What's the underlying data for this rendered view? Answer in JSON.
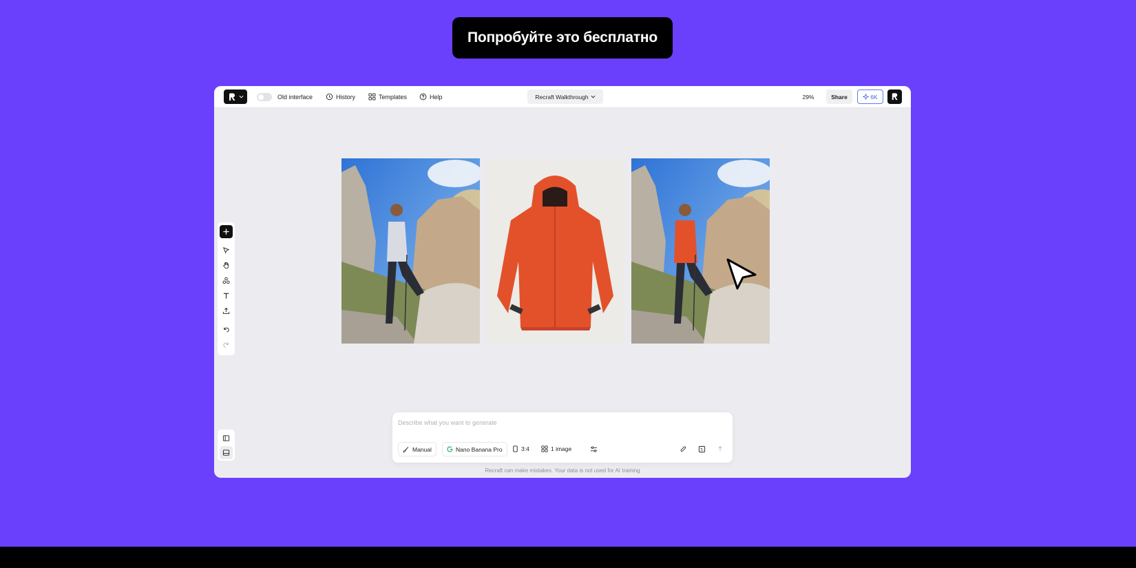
{
  "cta": {
    "label": "Попробуйте это бесплатно"
  },
  "colors": {
    "page_background": "#6a40fd",
    "accent": "#4a5fd8",
    "dark": "#111111"
  },
  "header": {
    "toggle_label": "Old interface",
    "history_label": "History",
    "templates_label": "Templates",
    "help_label": "Help",
    "project_name": "Recraft Walkthrough",
    "zoom": "29%",
    "share_label": "Share",
    "credits": "6K"
  },
  "toolbar": {
    "tools": [
      "add-icon",
      "select-cursor-icon",
      "hand-icon",
      "shapes-icon",
      "text-icon",
      "upload-icon",
      "undo-icon",
      "redo-icon"
    ]
  },
  "canvas": {
    "images": [
      "hiker-in-grey-jacket",
      "orange-rain-jacket",
      "hiker-in-orange-jacket"
    ]
  },
  "prompt": {
    "placeholder": "Describe what you want to generate",
    "mode_label": "Manual",
    "model_label": "Nano Banana Pro",
    "ratio_label": "3:4",
    "count_label": "1 image"
  },
  "footer": {
    "disclaimer": "Recraft can make mistakes. Your data is not used for AI training"
  }
}
